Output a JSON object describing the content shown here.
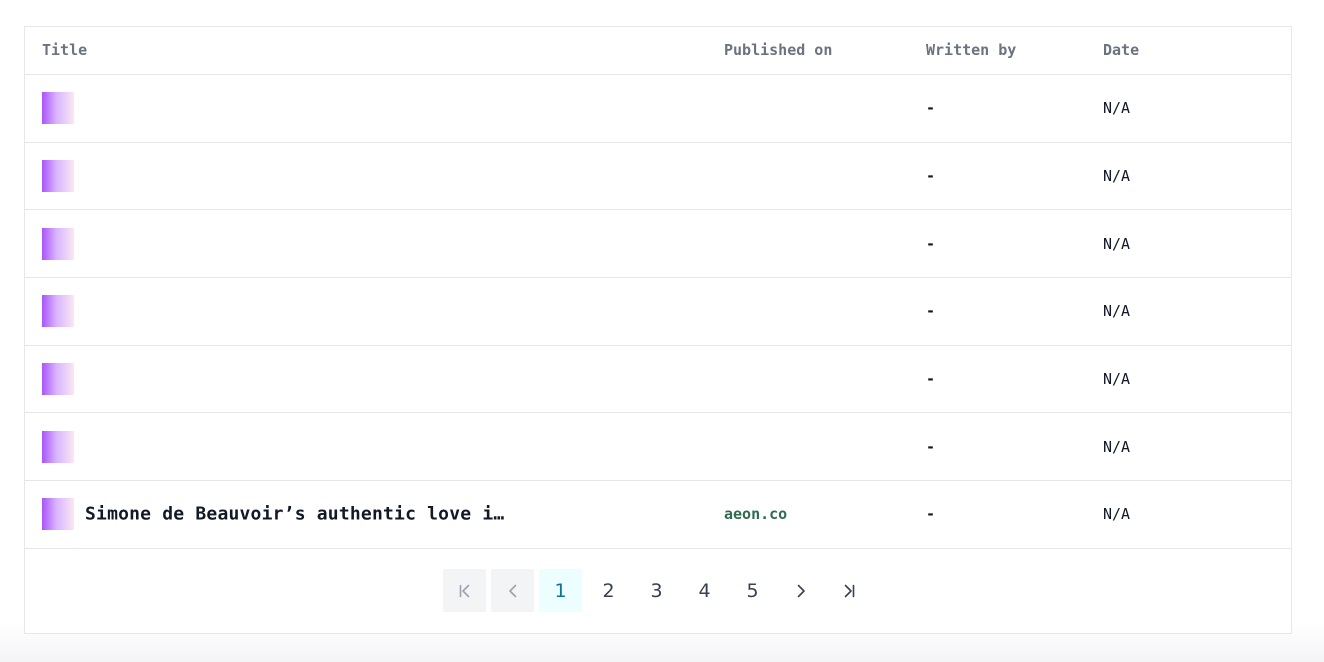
{
  "table": {
    "headers": {
      "title": "Title",
      "published_on": "Published on",
      "written_by": "Written by",
      "date": "Date"
    },
    "rows": [
      {
        "title": "",
        "published_on": "",
        "written_by": "-",
        "date": "N/A"
      },
      {
        "title": "",
        "published_on": "",
        "written_by": "-",
        "date": "N/A"
      },
      {
        "title": "",
        "published_on": "",
        "written_by": "-",
        "date": "N/A"
      },
      {
        "title": "",
        "published_on": "",
        "written_by": "-",
        "date": "N/A"
      },
      {
        "title": "",
        "published_on": "",
        "written_by": "-",
        "date": "N/A"
      },
      {
        "title": "",
        "published_on": "",
        "written_by": "-",
        "date": "N/A"
      },
      {
        "title": "Simone de Beauvoir’s authentic love i…",
        "published_on": "aeon.co",
        "written_by": "-",
        "date": "N/A"
      }
    ]
  },
  "pagination": {
    "pages": [
      "1",
      "2",
      "3",
      "4",
      "5"
    ],
    "current": "1",
    "first_icon": "first-page-icon",
    "prev_icon": "chevron-left-icon",
    "next_icon": "chevron-right-icon",
    "last_icon": "last-page-icon"
  },
  "colors": {
    "border": "#e5e7eb",
    "header_text": "#6b7280",
    "source_link": "#2f6b4f",
    "active_page_bg": "#ecfeff",
    "active_page_text": "#0e7490",
    "disabled_bg": "#f3f4f6"
  }
}
